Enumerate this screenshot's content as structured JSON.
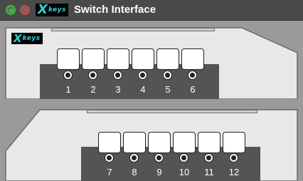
{
  "window": {
    "title": "Switch Interface",
    "logo_text": "keys",
    "logo_mark": "X"
  },
  "panels": [
    {
      "name": "top",
      "keys": [
        "1",
        "2",
        "3",
        "4",
        "5",
        "6"
      ]
    },
    {
      "name": "bottom",
      "keys": [
        "7",
        "8",
        "9",
        "10",
        "11",
        "12"
      ]
    }
  ],
  "colors": {
    "panel_face": "#e8e8e8",
    "key_bed": "#545454",
    "logo_text": "#2bd3d3",
    "close_button": "#3dbb3d",
    "minimize_button": "#c24a4a"
  },
  "icons": [
    "close-dot-icon",
    "minimize-dot-icon",
    "xkeys-logo"
  ]
}
